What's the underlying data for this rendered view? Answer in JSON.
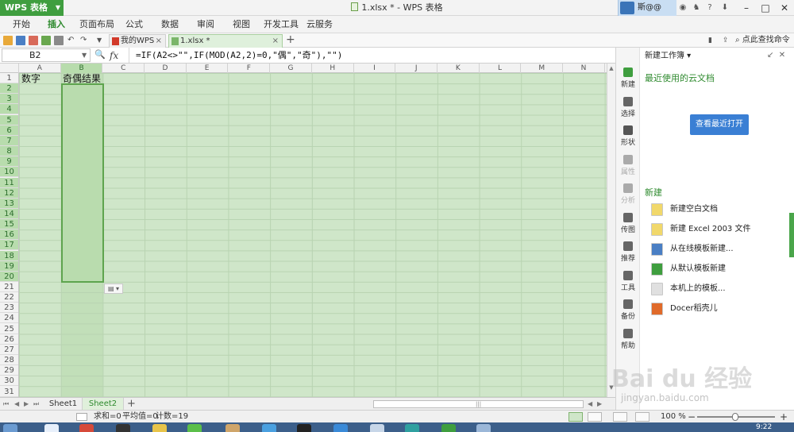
{
  "titlebar": {
    "app_button": "WPS 表格",
    "window_title": "1.xlsx * - WPS 表格",
    "user_name": "斯@@",
    "help_label": "?"
  },
  "menu": {
    "items": [
      {
        "label": "开始"
      },
      {
        "label": "插入"
      },
      {
        "label": "页面布局"
      },
      {
        "label": "公式"
      },
      {
        "label": "数据"
      },
      {
        "label": "审阅"
      },
      {
        "label": "视图"
      },
      {
        "label": "开发工具"
      },
      {
        "label": "云服务"
      }
    ],
    "active_index": 1
  },
  "doc_tabs": [
    {
      "label": "我的WPS",
      "active": false
    },
    {
      "label": "1.xlsx *",
      "active": true
    }
  ],
  "search_commands": "点此查找命令",
  "formula_bar": {
    "cell_ref": "B2",
    "fx": "fx",
    "formula": "=IF(A2<>\"\",IF(MOD(A2,2)=0,\"偶\",\"奇\"),\"\")"
  },
  "grid": {
    "columns": [
      "A",
      "B",
      "C",
      "D",
      "E",
      "F",
      "G",
      "H",
      "I",
      "J",
      "K",
      "L",
      "M",
      "N"
    ],
    "selected_column": "B",
    "row_count": 31,
    "selected_rows": [
      2,
      20
    ],
    "cells": {
      "A1": "数字",
      "B1": "奇偶结果"
    }
  },
  "sheets": [
    {
      "label": "Sheet1",
      "active": false
    },
    {
      "label": "Sheet2",
      "active": true
    }
  ],
  "side_panel": {
    "title": "新建工作簿 ▾",
    "strip_items": [
      {
        "label": "新建",
        "icon": "new-doc-icon",
        "disabled": false
      },
      {
        "label": "选择",
        "icon": "select-icon",
        "disabled": false
      },
      {
        "label": "形状",
        "icon": "shapes-icon",
        "disabled": false
      },
      {
        "label": "属性",
        "icon": "properties-icon",
        "disabled": true
      },
      {
        "label": "分析",
        "icon": "analysis-icon",
        "disabled": true
      },
      {
        "label": "传图",
        "icon": "upload-image-icon",
        "disabled": false
      },
      {
        "label": "推荐",
        "icon": "recommend-icon",
        "disabled": false
      },
      {
        "label": "工具",
        "icon": "toolbox-icon",
        "disabled": false
      },
      {
        "label": "备份",
        "icon": "backup-icon",
        "disabled": false
      },
      {
        "label": "帮助",
        "icon": "help-icon",
        "disabled": false
      }
    ],
    "recent_cloud": "最近使用的云文档",
    "open_recent_button": "查看最近打开",
    "new_heading": "新建",
    "new_items": [
      {
        "label": "新建空白文档",
        "icon": "blank-doc-icon"
      },
      {
        "label": "新建 Excel 2003 文件",
        "icon": "excel2003-icon"
      },
      {
        "label": "从在线模板新建...",
        "icon": "online-template-icon"
      },
      {
        "label": "从默认模板新建",
        "icon": "default-template-icon"
      },
      {
        "label": "本机上的模板...",
        "icon": "local-template-icon"
      },
      {
        "label": "Docer稻壳儿",
        "icon": "docer-icon"
      }
    ]
  },
  "status": {
    "sum": "求和=0",
    "average": "平均值=0",
    "count": "计数=19",
    "zoom": "100 %"
  },
  "taskbar": {
    "clock": "9:22"
  },
  "watermark": {
    "logo": "Bai du 经验",
    "url": "jingyan.baidu.com"
  },
  "colors": {
    "accent": "#3f9e3f",
    "selection_border": "#5ea44e",
    "grid_bg": "#cfe6c9",
    "button_blue": "#3a7fd4"
  }
}
